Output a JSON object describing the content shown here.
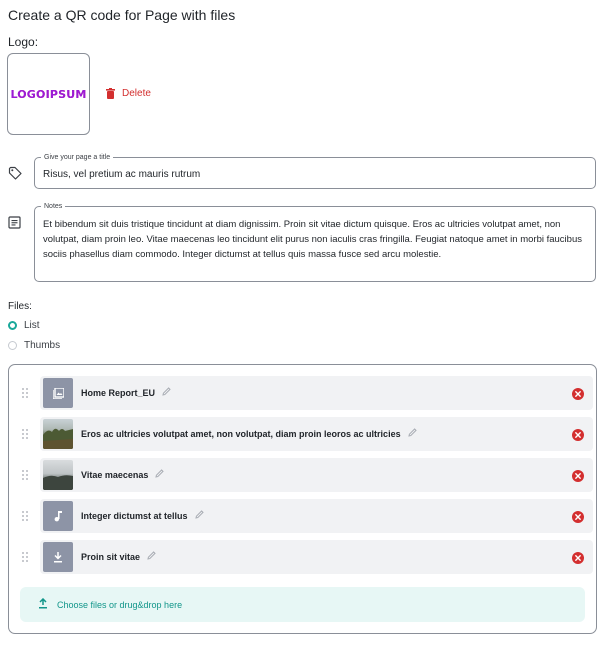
{
  "header": {
    "title": "Create a QR code for Page with files"
  },
  "logo": {
    "label": "Logo:",
    "text": "LOGOIPSUM",
    "colors": [
      "#6d1fd8",
      "#e0457b"
    ],
    "delete_label": "Delete"
  },
  "title_field": {
    "legend": "Give your page a title",
    "value": "Risus, vel pretium ac mauris rutrum",
    "icon": "tag-icon"
  },
  "notes_field": {
    "legend": "Notes",
    "value": "Et bibendum sit duis tristique tincidunt at diam dignissim. Proin sit vitae dictum quisque. Eros ac ultricies volutpat amet, non volutpat, diam proin leo. Vitae maecenas leo tincidunt elit purus non iaculis cras fringilla. Feugiat natoque amet in morbi faucibus sociis phasellus diam commodo. Integer dictumst at tellus quis massa fusce sed arcu molestie.",
    "icon": "notes-icon"
  },
  "files": {
    "label": "Files:",
    "view_options": [
      {
        "label": "List",
        "selected": true
      },
      {
        "label": "Thumbs",
        "selected": false
      }
    ],
    "items": [
      {
        "name": "Home Report_EU",
        "thumb": "image-file-icon"
      },
      {
        "name": "Eros ac ultricies volutpat amet, non volutpat, diam proin leoros ac ultricies",
        "thumb": "photo-thumbnail"
      },
      {
        "name": "Vitae maecenas",
        "thumb": "photo-thumbnail"
      },
      {
        "name": "Integer dictumst at tellus",
        "thumb": "music-note-icon"
      },
      {
        "name": "Proin sit vitae",
        "thumb": "download-icon"
      }
    ],
    "upload_label": "Choose files or drug&drop here"
  },
  "colors": {
    "accent": "#1aa89a",
    "danger": "#d32f2f",
    "thumb_bg": "#8d94a6"
  }
}
